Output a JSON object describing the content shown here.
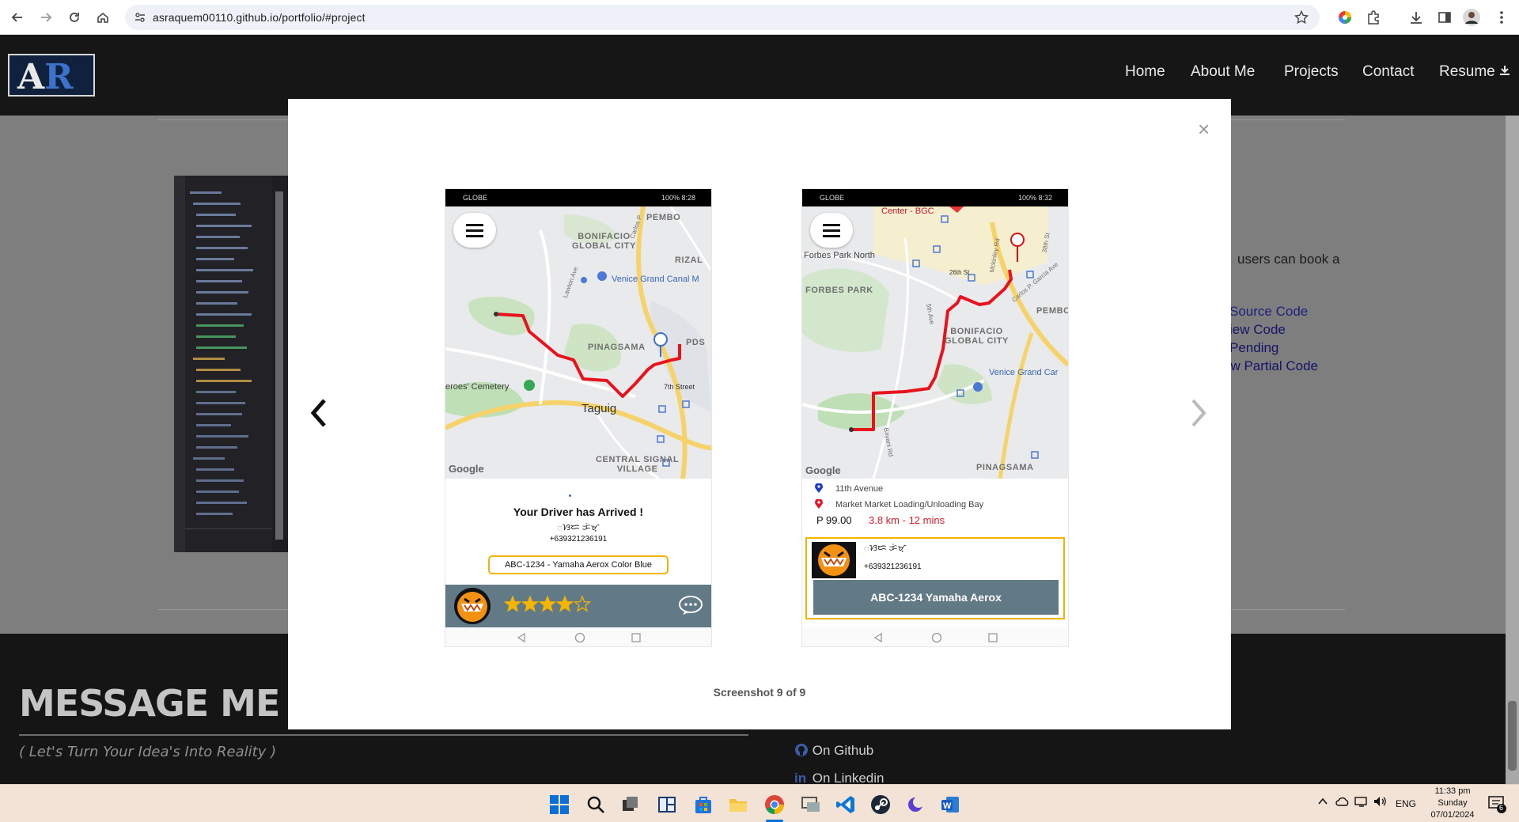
{
  "browser": {
    "url": "asraquem00110.github.io/portfolio/#project"
  },
  "site": {
    "logo_text": "AR",
    "nav": [
      "Home",
      "About Me",
      "Projects",
      "Contact",
      "Resume"
    ],
    "bg_text": {
      "line1": "users can book a",
      "source": "Source Code",
      "view": "iew Code",
      "pending": "Pending",
      "partial": "ew Partial Code"
    }
  },
  "footer": {
    "title": "MESSAGE ME",
    "subtitle": "( Let's Turn Your Idea's Into Reality )",
    "github": "On Github",
    "linkedin": "On Linkedin"
  },
  "modal": {
    "close": "×",
    "caption": "Screenshot 9 of 9"
  },
  "phone1": {
    "status_left": "GLOBE",
    "status_right": "100% 8:28",
    "map_labels": [
      "PEMBO",
      "BONIFACIO\nGLOBAL CITY",
      "RIZAL",
      "Venice Grand Canal M",
      "PINAGSAMA",
      "PDS",
      "eroes' Cemetery",
      "7th Street",
      "Taguig",
      "CENTRAL SIGNAL\nVILLAGE",
      "Lawton Ave",
      "Carlos P"
    ],
    "google": "Google",
    "title": "Your Driver has Arrived !",
    "driver_name": "ᜀᜐᜇ ᜃᜒᜋ᜔",
    "phone": "+639321236191",
    "plate": "ABC-1234 - Yamaha Aerox Color Blue",
    "rating": 4,
    "rating_max": 5
  },
  "phone2": {
    "status_left": "GLOBE",
    "status_right": "100% 8:32",
    "map_labels": [
      "Center - BGC",
      "Forbes Park North",
      "FORBES PARK",
      "26th St",
      "PEMBO",
      "BONIFACIO\nGLOBAL CITY",
      "Venice Grand Car",
      "PINAGSAMA",
      "38th St",
      "5th Ave",
      "Carlos P. Garcia Ave",
      "Bayani Rd",
      "Mckinley Rd"
    ],
    "google": "Google",
    "pickup": "11th Avenue",
    "dropoff": "Market Market Loading/Unloading Bay",
    "price": "P 99.00",
    "distance": "3.8 km - 12 mins",
    "driver_name": "ᜀᜐᜇ ᜃᜒᜋ᜔",
    "phone": "+639321236191",
    "plate": "ABC-1234 Yamaha Aerox"
  },
  "taskbar": {
    "lang": "ENG",
    "time": "11:33 pm",
    "day": "Sunday",
    "date": "07/01/2024",
    "notif": "6"
  },
  "colors": {
    "route": "#e8121c",
    "accent": "#f5b400",
    "header": "#161616",
    "modal": "#ffffff"
  }
}
